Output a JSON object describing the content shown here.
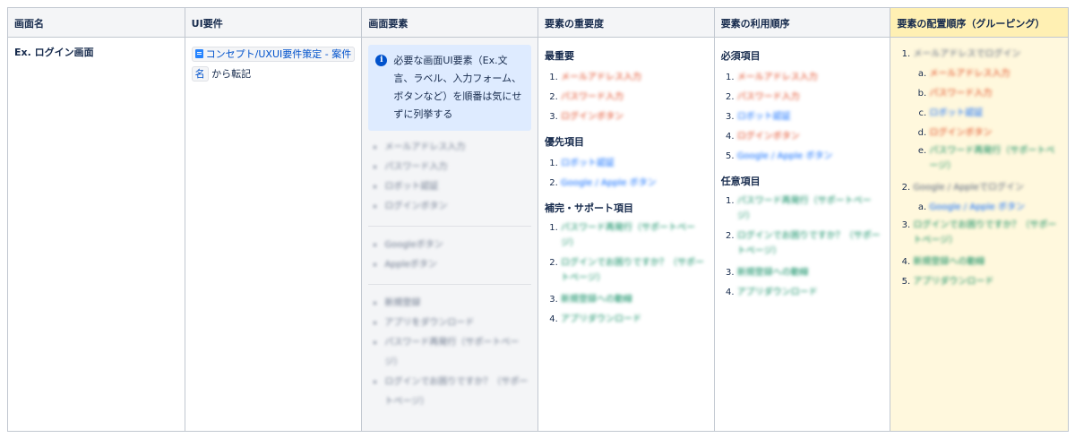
{
  "headers": [
    "画面名",
    "UI要件",
    "画面要素",
    "要素の重要度",
    "要素の利用順序",
    "要素の配置順序（グルーピング）"
  ],
  "row": {
    "screen_name": "Ex. ログイン画面",
    "ui_req": {
      "link_text_1": "コンセプト/UXUI要件策定 - 案件",
      "link_text_2": "名",
      "suffix": "から転記"
    },
    "elements": {
      "panel_text": "必要な画面UI要素（Ex.文言、ラベル、入力フォーム、ボタンなど）を順番は気にせずに列挙する",
      "group1": [
        "メールアドレス入力",
        "パスワード入力",
        "ロボット認証",
        "ログインボタン"
      ],
      "group2": [
        "Googleボタン",
        "Appleボタン"
      ],
      "group3": [
        "新規登録",
        "アプリをダウンロード",
        "パスワード再発行（サポートページ）",
        "ログインでお困りですか？（サポートページ）"
      ]
    },
    "importance": {
      "s1_title": "最重要",
      "s1": [
        "メールアドレス入力",
        "パスワード入力",
        "ログインボタン"
      ],
      "s2_title": "優先項目",
      "s2": [
        "ロボット認証",
        "Google / Apple ボタン"
      ],
      "s3_title": "補完・サポート項目",
      "s3": [
        "パスワード再発行（サポートページ）",
        "ログインでお困りですか？（サポートページ）",
        "新規登録への動線",
        "アプリダウンロード"
      ]
    },
    "usage": {
      "s1_title": "必須項目",
      "s1": [
        "メールアドレス入力",
        "パスワード入力",
        "ロボット認証",
        "ログインボタン",
        "Google / Apple ボタン"
      ],
      "s2_title": "任意項目",
      "s2": [
        "パスワード再発行（サポートページ）",
        "ログインでお困りですか？（サポートページ）",
        "新規登録への動線",
        "アプリダウンロード"
      ]
    },
    "placement": {
      "g1": "メールアドレスでログイン",
      "g1_items": [
        "メールアドレス入力",
        "パスワード入力",
        "ロボット認証",
        "ログインボタン",
        "パスワード再発行（サポートページ）"
      ],
      "g2": "Google / Appleでログイン",
      "g2_items": [
        "Google / Apple ボタン"
      ],
      "g3": "ログインでお困りですか？（サポートページ）",
      "g4": "新規登録への動線",
      "g5": "アプリダウンロード"
    }
  }
}
